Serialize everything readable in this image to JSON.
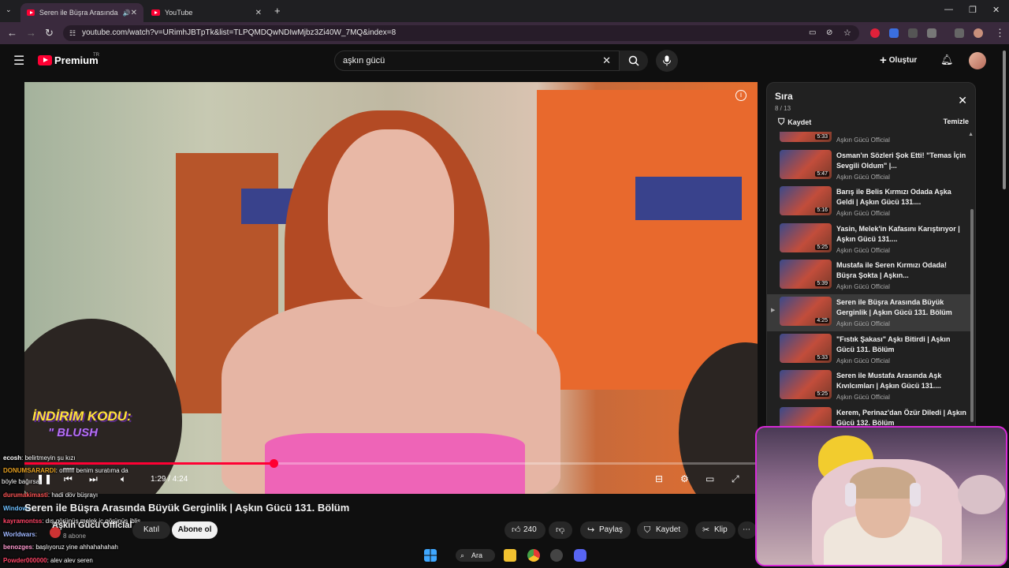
{
  "browser": {
    "tabs": [
      {
        "title": "Seren ile Büşra Arasında Bü",
        "active": true
      },
      {
        "title": "YouTube",
        "active": false
      }
    ],
    "new_tab": "+",
    "url": "youtube.com/watch?v=URimhJBTpTk&list=TLPQMDQwNDIwMjbz3Zi40W_7MQ&index=8"
  },
  "header": {
    "logo": "Premium",
    "country_code": "TR",
    "search_value": "aşkın gücü",
    "create_label": "Oluştur"
  },
  "player": {
    "promo_line1": "İNDİRİM KODU:",
    "promo_line2": "\" BLUSH",
    "time": "1:29 / 4:24",
    "progress": 0.34
  },
  "video": {
    "title": "Seren ile Büşra Arasında Büyük Gerginlik | Aşkın Gücü 131. Bölüm",
    "channel": "Aşkın Gücü Official",
    "subscribers": "8 abone",
    "join_label": "Katıl",
    "subscribe_label": "Abone ol",
    "likes": "240",
    "share_label": "Paylaş",
    "save_label": "Kaydet",
    "clip_label": "Klip"
  },
  "chat": [
    {
      "user": "ecosh",
      "text": ": belirtmeyin şu kızı",
      "color": "#ffffff"
    },
    {
      "user": "DONUMSARARDI",
      "text": ": offfffff benim suratıma da",
      "color": "#e6a020"
    },
    {
      "user": "",
      "text": "böyle bağırsa",
      "color": "#ffffff"
    },
    {
      "user": "durumakimasti",
      "text": ": hadi döv büşrayı",
      "color": "#ff5555"
    },
    {
      "user": "Windows",
      "text": "",
      "color": "#6ec0ff"
    },
    {
      "user": "kayramontss",
      "text": ": dış görünüş melek iç görünüş iblis",
      "color": "#ff4466"
    },
    {
      "user": "Worldwars",
      "text": ":",
      "color": "#9fb7ff"
    },
    {
      "user": "benozges",
      "text": ": başlıyoruz yine ahhahahahah",
      "color": "#ff9ad0"
    },
    {
      "user": "Powder000000",
      "text": ": alev alev seren",
      "color": "#ff4466"
    }
  ],
  "playlist": {
    "title": "Sıra",
    "count": "8 / 13",
    "save_label": "Kaydet",
    "clear_label": "Temizle",
    "items": [
      {
        "title": "",
        "channel": "Aşkın Gücü Official",
        "duration": "5:33"
      },
      {
        "title": "Osman'ın Sözleri Şok Etti! \"Temas İçin Sevgili Oldum\" |...",
        "channel": "Aşkın Gücü Official",
        "duration": "5:47"
      },
      {
        "title": "Barış ile Belis Kırmızı Odada Aşka Geldi | Aşkın Gücü 131....",
        "channel": "Aşkın Gücü Official",
        "duration": "5:16"
      },
      {
        "title": "Yasin, Melek'in Kafasını Karıştırıyor | Aşkın Gücü 131....",
        "channel": "Aşkın Gücü Official",
        "duration": "5:25"
      },
      {
        "title": "Mustafa ile Seren Kırmızı Odada! Büşra Şokta | Aşkın...",
        "channel": "Aşkın Gücü Official",
        "duration": "5:39"
      },
      {
        "title": "Seren ile Büşra Arasında Büyük Gerginlik | Aşkın Gücü 131. Bölüm",
        "channel": "Aşkın Gücü Official",
        "duration": "4:25"
      },
      {
        "title": "\"Fıstık Şakası\" Aşkı Bitirdi | Aşkın Gücü 131. Bölüm",
        "channel": "Aşkın Gücü Official",
        "duration": "5:33"
      },
      {
        "title": "Seren ile Mustafa Arasında Aşk Kıvılcımları | Aşkın Gücü 131....",
        "channel": "Aşkın Gücü Official",
        "duration": "5:25"
      },
      {
        "title": "Kerem, Perinaz'dan Özür Diledi | Aşkın Gücü 132. Bölüm",
        "channel": "",
        "duration": ""
      }
    ],
    "current_index": 5
  },
  "taskbar": {
    "search_label": "Ara"
  }
}
